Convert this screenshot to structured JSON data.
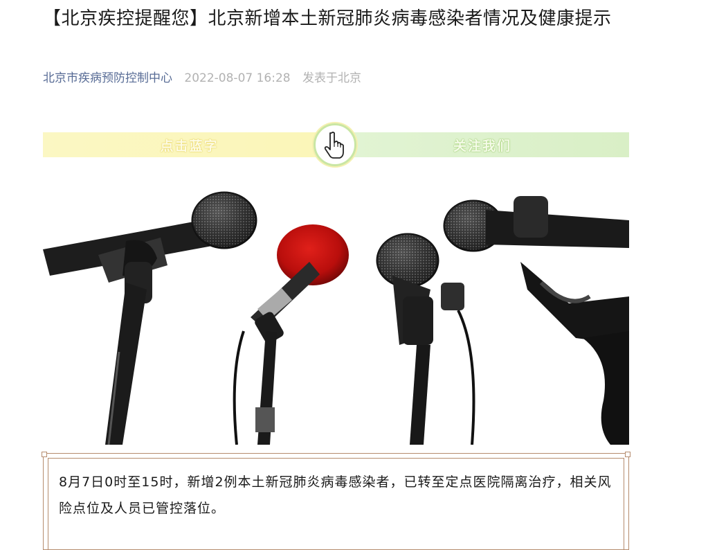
{
  "article": {
    "title": "【北京疾控提醒您】北京新增本土新冠肺炎病毒感染者情况及健康提示",
    "author": "北京市疾病预防控制中心",
    "date": "2022-08-07 16:28",
    "location": "发表于北京"
  },
  "banner": {
    "left_text": "点击蓝字",
    "right_text": "关注我们",
    "left_color": "#fbf7c3",
    "right_color": "#e2f4d4",
    "icon": "pointing-hand-icon"
  },
  "image": {
    "subject": "microphones"
  },
  "notice": {
    "text": "8月7日0时至15时，新增2例本土新冠肺炎病毒感染者，已转至定点医院隔离治疗，相关风险点位及人员已管控落位。",
    "border_color": "#b58b6d"
  }
}
